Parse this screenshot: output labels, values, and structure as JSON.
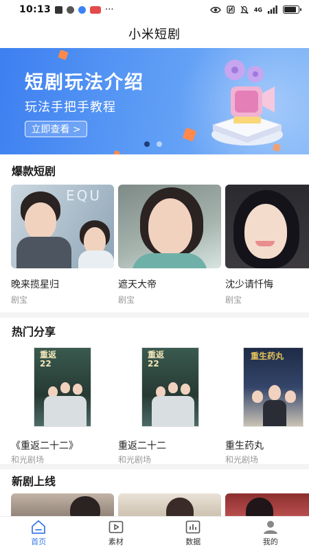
{
  "status_bar": {
    "time": "10:13",
    "dots": "···",
    "network": "4G"
  },
  "app_title": "小米短剧",
  "banner": {
    "title": "短剧玩法介绍",
    "subtitle": "玩法手把手教程",
    "button_label": "立即查看 >",
    "active_slide": 1,
    "slide_count": 2
  },
  "sections": {
    "hot_dramas": {
      "title": "爆款短剧",
      "items": [
        {
          "title": "晚来揽星归",
          "source": "剧宝",
          "poster_text": "EQU"
        },
        {
          "title": "遮天大帝",
          "source": "剧宝"
        },
        {
          "title": "沈少请忏悔",
          "source": "剧宝"
        }
      ]
    },
    "hot_share": {
      "title": "热门分享",
      "items": [
        {
          "title": "《重返二十二》",
          "source": "和光剧场",
          "poster_text": "重返22"
        },
        {
          "title": "重返二十二",
          "source": "和光剧场",
          "poster_text": "重返22"
        },
        {
          "title": "重生药丸",
          "source": "和光剧场",
          "poster_text": "重生药丸"
        }
      ]
    },
    "new_release": {
      "title": "新剧上线"
    }
  },
  "tab_bar": {
    "items": [
      {
        "label": "首页",
        "icon": "home-icon",
        "active": true
      },
      {
        "label": "素材",
        "icon": "video-icon",
        "active": false
      },
      {
        "label": "数据",
        "icon": "chart-icon",
        "active": false
      },
      {
        "label": "我的",
        "icon": "user-icon",
        "active": false
      }
    ]
  },
  "colors": {
    "accent": "#3c7be6",
    "banner_start": "#3d7ff0",
    "banner_end": "#7fb5f8"
  }
}
